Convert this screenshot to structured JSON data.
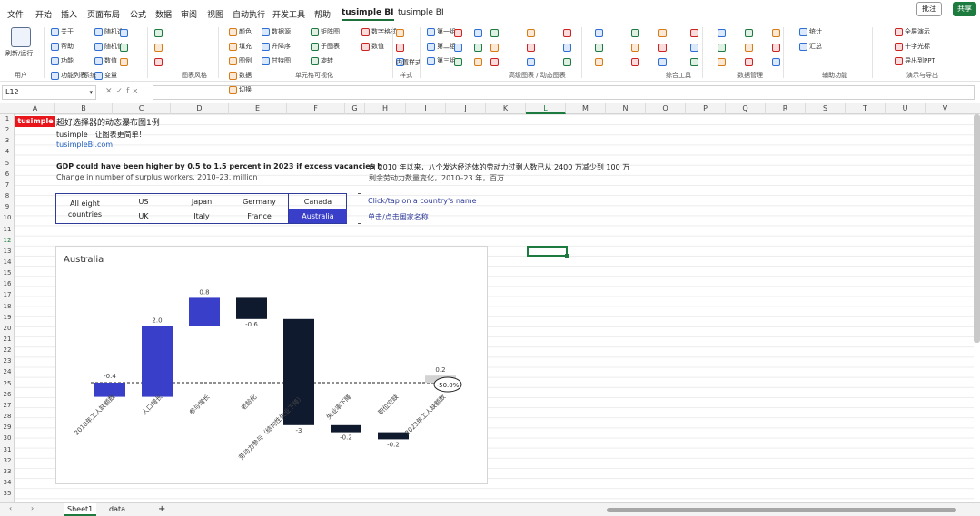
{
  "menu": {
    "items": [
      "文件",
      "开始",
      "插入",
      "页面布局",
      "公式",
      "数据",
      "审阅",
      "视图",
      "自动执行",
      "开发工具",
      "帮助",
      "tusimple BI",
      "tusimple BI"
    ],
    "active_index": 11,
    "comments": "批注",
    "share": "共享"
  },
  "ribbon": {
    "col1": [
      "刷新/运行",
      "关于",
      "帮助",
      "功能",
      "功能列表"
    ],
    "col2": [
      "随机选",
      "随机值",
      "数值",
      "变量"
    ],
    "col3": [
      "颜色",
      "填充",
      "图例",
      "数据",
      "切换"
    ],
    "col4": [
      "数据源",
      "升降序",
      "甘特图",
      "矩阵图",
      "子图表",
      "旋转",
      "数字格式",
      "数值"
    ],
    "col5": [
      "内置样式"
    ],
    "col6": [
      "第一组",
      "第二组",
      "第三组"
    ],
    "col7": [
      "统计",
      "汇总"
    ],
    "col8": [
      "全屏演示",
      "十字光标",
      "导出到PPT"
    ],
    "group_labels": [
      "用户",
      "系统",
      "图表风格",
      "单元格可视化",
      "样式",
      "高级图表 / 动态图表",
      "综合工具",
      "数据管理",
      "辅助功能",
      "演示与导出"
    ]
  },
  "formula_bar": {
    "name_box": "L12",
    "fx": "fx",
    "value": ""
  },
  "columns": [
    "A",
    "B",
    "C",
    "D",
    "E",
    "F",
    "G",
    "H",
    "I",
    "J",
    "K",
    "L",
    "M",
    "N",
    "O",
    "P",
    "Q",
    "R",
    "S",
    "T",
    "U",
    "V"
  ],
  "selected_column": "L",
  "rows": [
    "1",
    "2",
    "3",
    "4",
    "5",
    "6",
    "7",
    "8",
    "9",
    "10",
    "11",
    "12",
    "13",
    "14",
    "15",
    "16",
    "17",
    "18",
    "19",
    "20",
    "21",
    "22",
    "23",
    "24",
    "25",
    "26",
    "27",
    "28",
    "29",
    "30",
    "31",
    "32",
    "33",
    "34",
    "35"
  ],
  "selected_row": "12",
  "cells": {
    "badge": "tusimple",
    "title": "超好选择器的动态瀑布图1例",
    "b2": "tusimple　让图表更简单！",
    "b3": "tusimpleBI.com",
    "headline_en": "GDP could have been higher by 0.5 to 1.5 percent in 2023 if excess vacancies h",
    "headline_cn": "自 2010 年以来，八个发达经济体的劳动力过剩人数已从 2400 万减少到 100 万",
    "subtitle_en": "Change in number of surplus workers, 2010–23, million",
    "subtitle_cn": "剩余劳动力数量变化，2010–23 年，百万",
    "hint_en": "Click/tap on a country's name",
    "hint_cn": "单击/点击国家名称"
  },
  "selector": {
    "all_label": "All eight countries",
    "countries_row1": [
      "US",
      "Japan",
      "Germany",
      "Canada"
    ],
    "countries_row2": [
      "UK",
      "Italy",
      "France",
      "Australia"
    ],
    "active": "Australia"
  },
  "chart_data": {
    "type": "bar",
    "title": "Australia",
    "categories": [
      "2010年工人缺额数",
      "人口增长",
      "参与增长",
      "老龄化",
      "劳动力参与（结构性失业下降）",
      "失业率下降",
      "职位空缺",
      "2023年工人缺额数"
    ],
    "values": [
      -0.4,
      2.0,
      0.8,
      -0.6,
      -3.0,
      -0.2,
      -0.2,
      0.2
    ],
    "value_labels": [
      "-0.4",
      "2.0",
      "0.8",
      "-0.6",
      "-3",
      "-0.2",
      "-0.2",
      "0.2"
    ],
    "end_annotation": "-50.0%",
    "colors": {
      "positive": "#3a3fc9",
      "negative": "#0f1a2e",
      "total": "#3a3fc9",
      "end": "#d3d3d3"
    }
  },
  "sheets": {
    "tabs": [
      "Sheet1",
      "data"
    ],
    "active": "Sheet1",
    "add": "+"
  }
}
